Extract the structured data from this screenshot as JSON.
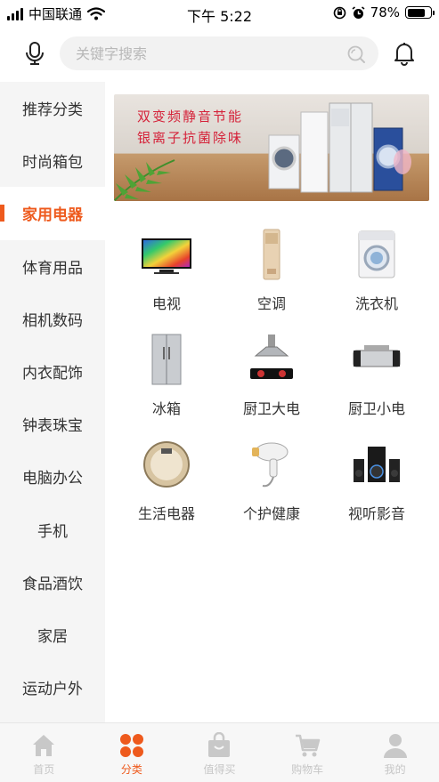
{
  "status_bar": {
    "carrier": "中国联通",
    "time": "下午 5:22",
    "battery_percent": "78%",
    "battery_level": 0.78
  },
  "search": {
    "placeholder": "关键字搜索",
    "value": ""
  },
  "sidebar": {
    "items": [
      {
        "label": "推荐分类",
        "active": false
      },
      {
        "label": "时尚箱包",
        "active": false
      },
      {
        "label": "家用电器",
        "active": true
      },
      {
        "label": "体育用品",
        "active": false
      },
      {
        "label": "相机数码",
        "active": false
      },
      {
        "label": "内衣配饰",
        "active": false
      },
      {
        "label": "钟表珠宝",
        "active": false
      },
      {
        "label": "电脑办公",
        "active": false
      },
      {
        "label": "手机",
        "active": false
      },
      {
        "label": "食品酒饮",
        "active": false
      },
      {
        "label": "家居",
        "active": false
      },
      {
        "label": "运动户外",
        "active": false
      }
    ],
    "accent_color": "#ee5a1d"
  },
  "banner": {
    "line1": "双变频静音节能",
    "line2": "银离子抗菌除味"
  },
  "categories": [
    {
      "label": "电视",
      "icon": "tv-icon"
    },
    {
      "label": "空调",
      "icon": "air-conditioner-icon"
    },
    {
      "label": "洗衣机",
      "icon": "washing-machine-icon"
    },
    {
      "label": "冰箱",
      "icon": "refrigerator-icon"
    },
    {
      "label": "厨卫大电",
      "icon": "range-hood-icon"
    },
    {
      "label": "厨卫小电",
      "icon": "water-purifier-icon"
    },
    {
      "label": "生活电器",
      "icon": "robot-vacuum-icon"
    },
    {
      "label": "个护健康",
      "icon": "hair-dryer-icon"
    },
    {
      "label": "视听影音",
      "icon": "speaker-system-icon"
    }
  ],
  "tabbar": {
    "items": [
      {
        "label": "首页",
        "icon": "home-icon",
        "active": false
      },
      {
        "label": "分类",
        "icon": "category-icon",
        "active": true
      },
      {
        "label": "值得买",
        "icon": "shopping-bag-icon",
        "active": false
      },
      {
        "label": "购物车",
        "icon": "cart-icon",
        "active": false
      },
      {
        "label": "我的",
        "icon": "user-icon",
        "active": false
      }
    ]
  }
}
